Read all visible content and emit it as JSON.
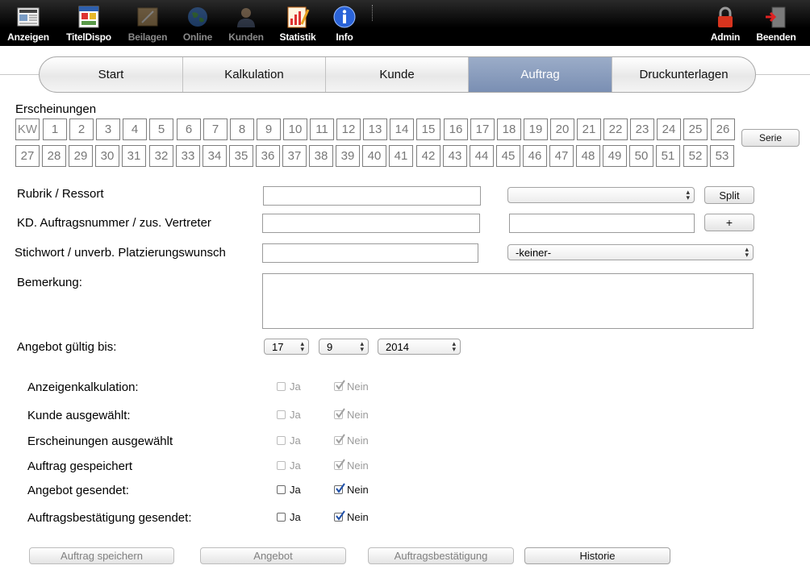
{
  "toolbar": {
    "items": [
      {
        "label": "Anzeigen",
        "icon": "newspaper-icon",
        "disabled": false
      },
      {
        "label": "TitelDispo",
        "icon": "magazine-icon",
        "disabled": false
      },
      {
        "label": "Beilagen",
        "icon": "insert-icon",
        "disabled": true
      },
      {
        "label": "Online",
        "icon": "globe-icon",
        "disabled": true
      },
      {
        "label": "Kunden",
        "icon": "person-icon",
        "disabled": true
      },
      {
        "label": "Statistik",
        "icon": "statistics-icon",
        "disabled": false
      },
      {
        "label": "Info",
        "icon": "info-icon",
        "disabled": false
      },
      {
        "label": "Admin",
        "icon": "lock-icon",
        "disabled": false
      },
      {
        "label": "Beenden",
        "icon": "exit-door-icon",
        "disabled": false
      }
    ]
  },
  "tabs": [
    {
      "label": "Start",
      "active": false
    },
    {
      "label": "Kalkulation",
      "active": false
    },
    {
      "label": "Kunde",
      "active": false
    },
    {
      "label": "Auftrag",
      "active": true
    },
    {
      "label": "Druckunterlagen",
      "active": false
    }
  ],
  "erscheinungen": {
    "title": "Erscheinungen",
    "kw_label": "KW",
    "weeks_row1": [
      "1",
      "2",
      "3",
      "4",
      "5",
      "6",
      "7",
      "8",
      "9",
      "10",
      "11",
      "12",
      "13",
      "14",
      "15",
      "16",
      "17",
      "18",
      "19",
      "20",
      "21",
      "22",
      "23",
      "24",
      "25",
      "26"
    ],
    "weeks_row2": [
      "27",
      "28",
      "29",
      "30",
      "31",
      "32",
      "33",
      "34",
      "35",
      "36",
      "37",
      "38",
      "39",
      "40",
      "41",
      "42",
      "43",
      "44",
      "45",
      "46",
      "47",
      "48",
      "49",
      "50",
      "51",
      "52",
      "53"
    ],
    "serie_button": "Serie"
  },
  "form": {
    "rubrik_label": "Rubrik / Ressort",
    "split_button": "Split",
    "auftragsnummer_label": "KD. Auftragsnummer / zus. Vertreter",
    "plus_button": "+",
    "stichwort_label": "Stichwort / unverb. Platzierungswunsch",
    "platzierung_value": "-keiner-",
    "bemerkung_label": "Bemerkung:",
    "angebot_label": "Angebot gültig bis:",
    "day_value": "17",
    "month_value": "9",
    "year_value": "2014"
  },
  "status": {
    "yes_label": "Ja",
    "no_label": "Nein",
    "rows": [
      {
        "label": "Anzeigenkalkulation:",
        "enabled": false
      },
      {
        "label": "Kunde ausgewählt:",
        "enabled": false
      },
      {
        "label": "Erscheinungen ausgewählt",
        "enabled": false
      },
      {
        "label": "Auftrag gespeichert",
        "enabled": false
      },
      {
        "label": "Angebot gesendet:",
        "enabled": true
      },
      {
        "label": "Auftragsbestätigung gesendet:",
        "enabled": true
      }
    ]
  },
  "actions": {
    "save_order": "Auftrag speichern",
    "offer": "Angebot",
    "confirmation": "Auftragsbestätigung",
    "history": "Historie"
  }
}
